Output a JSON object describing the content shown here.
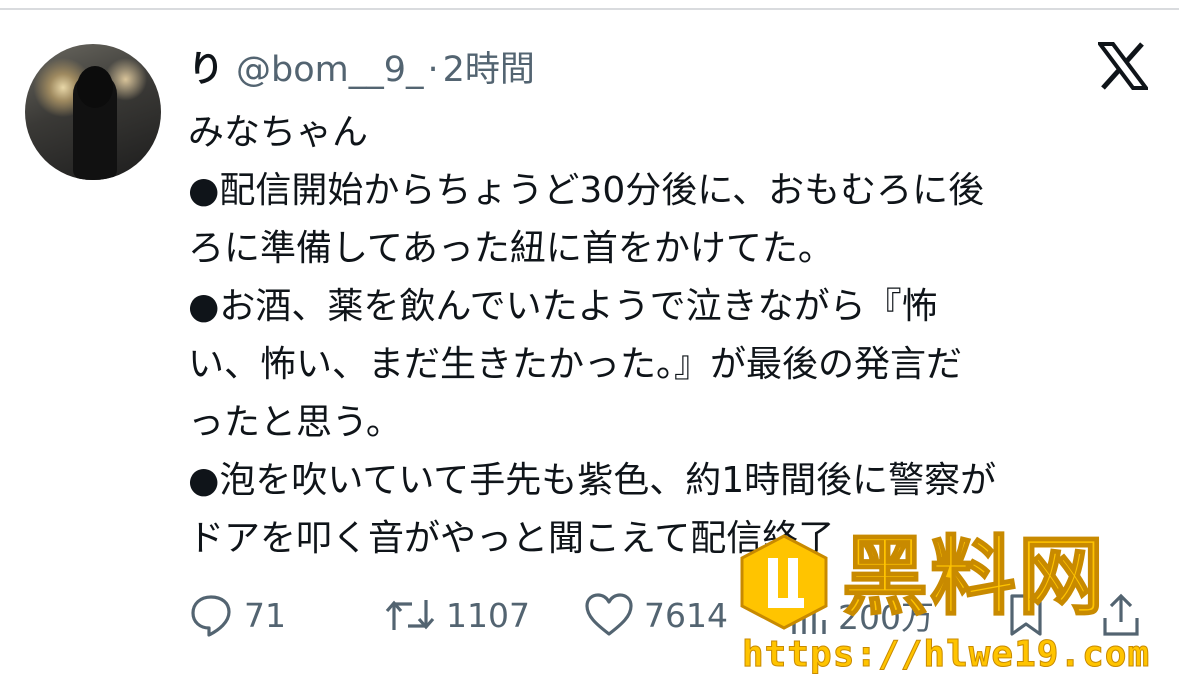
{
  "post": {
    "author_name": "り",
    "handle": "@bom__9_",
    "separator": "·",
    "time": "2時間",
    "lines": [
      "みなちゃん",
      "●配信開始からちょうど30分後に、おもむろに後",
      "ろに準備してあった紐に首をかけてた。",
      "●お酒、薬を飲んでいたようで泣きながら『怖",
      "い、怖い、まだ生きたかった。』が最後の発言だ",
      "ったと思う。",
      "●泡を吹いていて手先も紫色、約1時間後に警察が",
      "ドアを叩く音がやっと聞こえて配信終了"
    ]
  },
  "actions": {
    "replies": "71",
    "reposts": "1107",
    "likes": "7614",
    "views": "200万"
  },
  "watermark": {
    "title": "黑料网",
    "url": "https://hlwe19.com"
  },
  "colors": {
    "text": "#0f1419",
    "secondary": "#536471",
    "watermark": "#ffc400"
  },
  "icons": [
    "x-logo-icon",
    "reply-icon",
    "repost-icon",
    "like-icon",
    "views-icon",
    "bookmark-icon",
    "share-icon"
  ]
}
